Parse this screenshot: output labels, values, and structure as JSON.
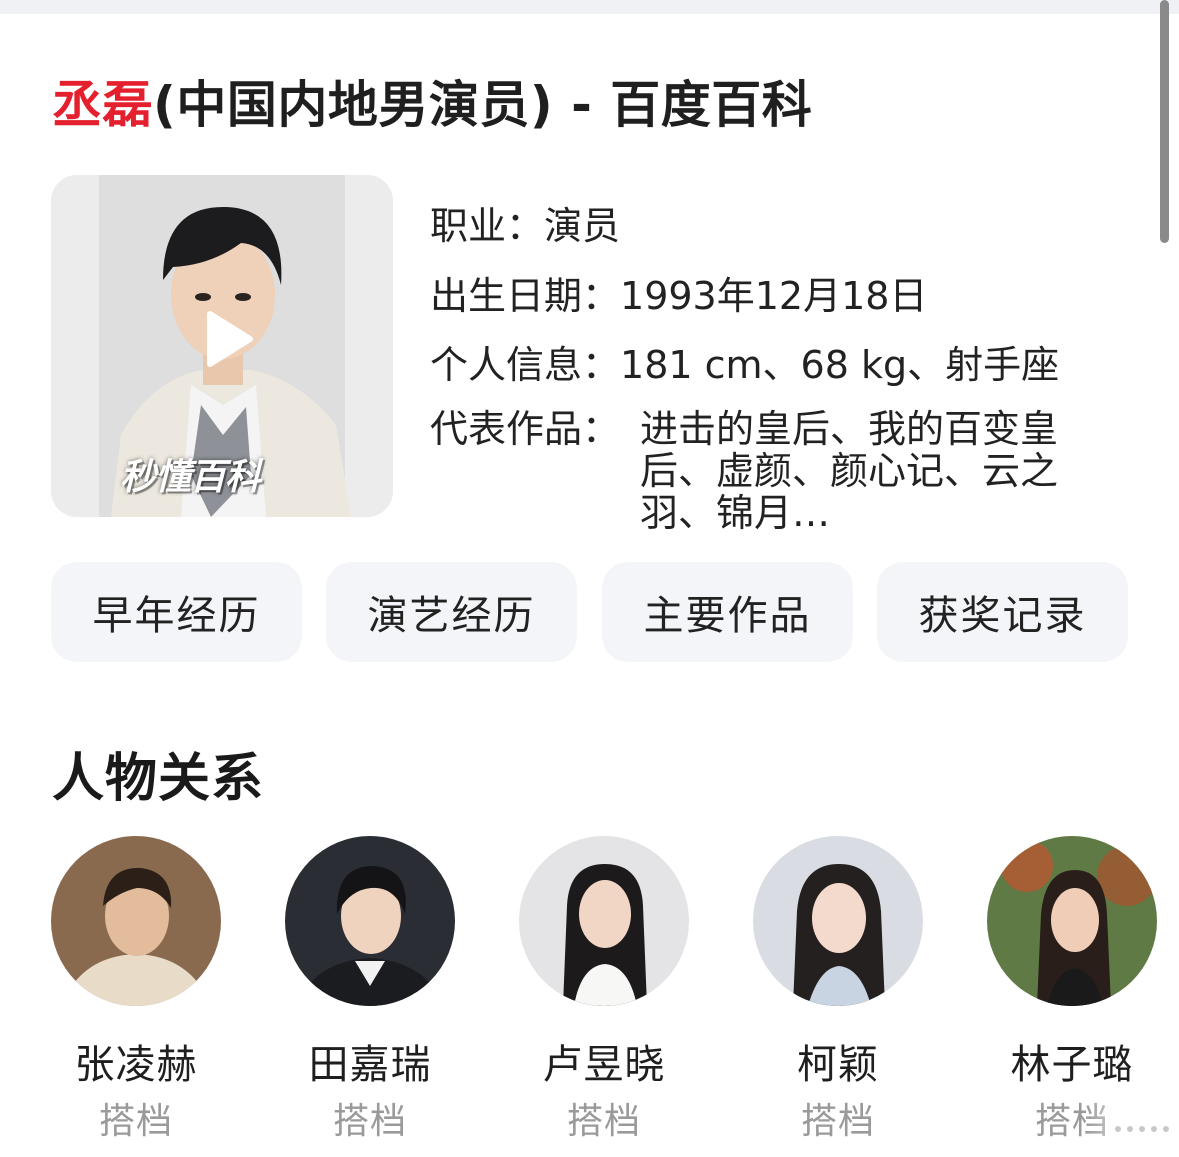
{
  "page": {
    "title_highlight": "丞磊",
    "title_rest": "(中国内地男演员) - 百度百科"
  },
  "hero": {
    "watermark": "秒懂百科",
    "play_icon": "play-icon"
  },
  "info": {
    "rows": [
      {
        "key": "职业：",
        "value": "演员"
      },
      {
        "key": "出生日期：",
        "value": "1993年12月18日"
      },
      {
        "key": "个人信息：",
        "value": "181 cm、68 kg、射手座"
      }
    ],
    "works_key": "代表作品：",
    "works_value": "进击的皇后、我的百变皇后、虚颜、颜心记、云之羽、锦月…"
  },
  "tabs": [
    "早年经历",
    "演艺经历",
    "主要作品",
    "获奖记录"
  ],
  "relations": {
    "title": "人物关系",
    "people": [
      {
        "name": "张凌赫",
        "relation": "搭档"
      },
      {
        "name": "田嘉瑞",
        "relation": "搭档"
      },
      {
        "name": "卢昱晓",
        "relation": "搭档"
      },
      {
        "name": "柯颖",
        "relation": "搭档"
      },
      {
        "name": "林子璐",
        "relation": "搭档"
      }
    ]
  },
  "colors": {
    "highlight": "#e5202e",
    "tab_bg": "#f4f5f8",
    "muted_text": "#9a9a9a"
  }
}
